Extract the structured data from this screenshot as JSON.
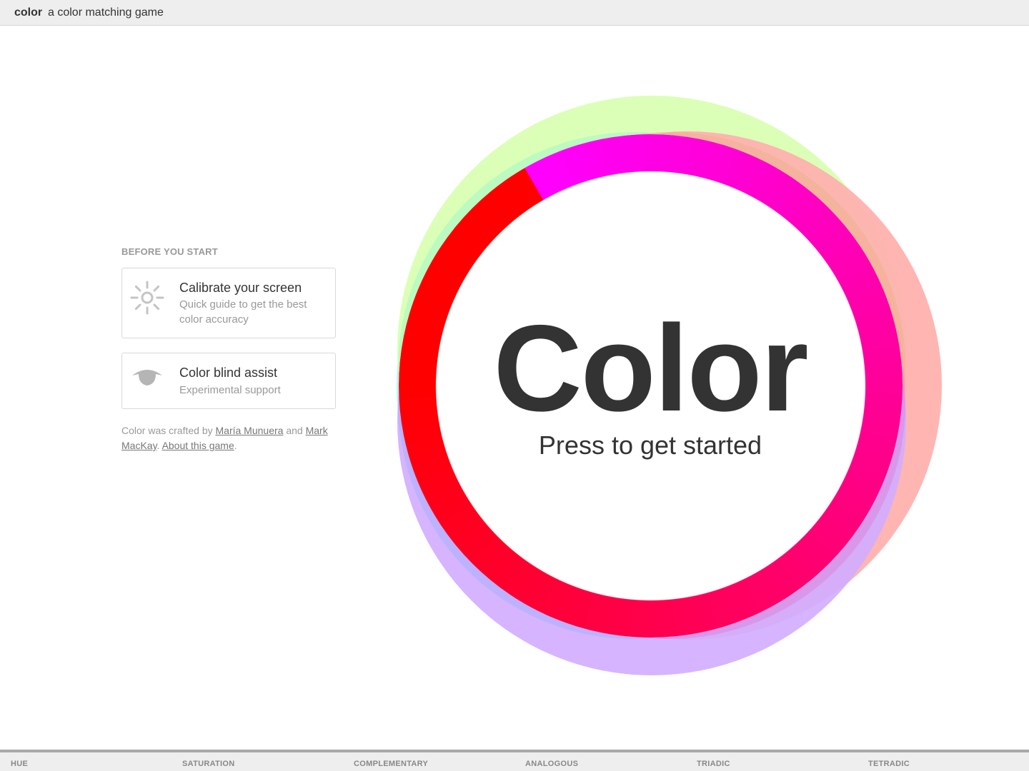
{
  "header": {
    "brand": "color",
    "tagline": "a color matching game"
  },
  "sidebar": {
    "heading": "BEFORE YOU START",
    "cards": [
      {
        "title": "Calibrate your screen",
        "description": "Quick guide to get the best color accuracy",
        "icon": "sun-icon"
      },
      {
        "title": "Color blind assist",
        "description": "Experimental support",
        "icon": "eye-icon"
      }
    ],
    "credits": {
      "prefix": "Color was crafted by ",
      "author1": "María Munuera",
      "joiner": " and ",
      "author2": "Mark MacKay",
      "separator": ". ",
      "about_link": "About this game",
      "suffix": "."
    }
  },
  "main": {
    "title": "Color",
    "subtitle": "Press to get started"
  },
  "footer": {
    "modes": [
      "HUE",
      "SATURATION",
      "COMPLEMENTARY",
      "ANALOGOUS",
      "TRIADIC",
      "TETRADIC"
    ]
  },
  "colors": {
    "ring_outer_green": "#d9ffb3",
    "ring_outer_cyan": "#aefcfc",
    "ring_outer_red": "#ffb1ae",
    "ring_outer_purple": "#d6b2ff",
    "text_dark": "#333333",
    "text_muted": "#999999"
  }
}
